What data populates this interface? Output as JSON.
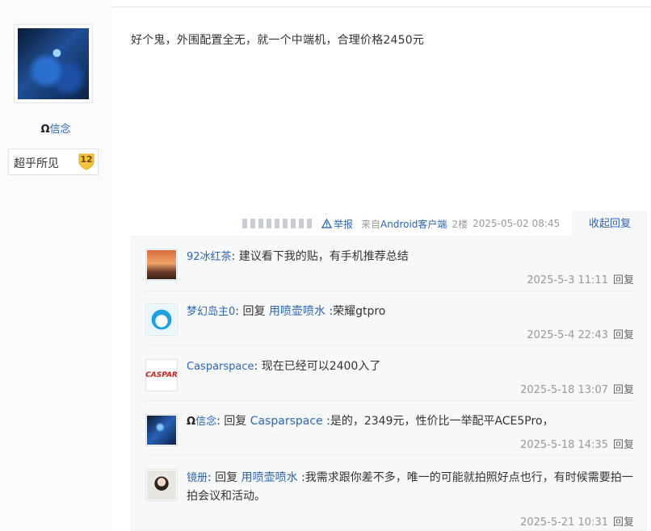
{
  "author": {
    "omega": "Ω",
    "name": "信念",
    "level_name": "超乎所见",
    "level": "12"
  },
  "post": {
    "content": "好个鬼，外围配置全无，就一个中端机，合理价格2450元",
    "report": "举报",
    "from_prefix": "来自",
    "client": "Android客户端",
    "floor": "2楼",
    "time": "2025-05-02 08:45",
    "collapse": "收起回复"
  },
  "replies": [
    {
      "user": "92冰红茶",
      "sep": ":",
      "content": " 建议看下我的贴，有手机推荐总结",
      "time": "2025-5-3 11:11",
      "reply_label": "回复"
    },
    {
      "user": "梦幻岛主0",
      "sep": ":",
      "reply_word": " 回复 ",
      "target": "用喷壶喷水",
      "content": " :荣耀gtpro",
      "time": "2025-5-4 22:43",
      "reply_label": "回复"
    },
    {
      "user": "Casparspace",
      "sep": ":",
      "content": " 现在已经可以2400入了",
      "time": "2025-5-18 13:07",
      "reply_label": "回复"
    },
    {
      "omega": "Ω",
      "user": "信念",
      "sep": ":",
      "reply_word": " 回复 ",
      "target": "Casparspace",
      "content": " :是的，2349元，性价比一举配平ACE5Pro，",
      "time": "2025-5-18 14:35",
      "reply_label": "回复"
    },
    {
      "user": "镜册",
      "sep": ":",
      "reply_word": " 回复 ",
      "target": "用喷壶喷水",
      "content": " :我需求跟你差不多，唯一的可能就拍照好点也行，有时候需要拍一拍会议和活动。",
      "time": "2025-5-21 10:31",
      "reply_label": "回复"
    }
  ],
  "icons": {
    "report": "warning-triangle-icon",
    "level": "shield-badge-icon"
  },
  "colors": {
    "link": "#2d64b3",
    "muted": "#999999",
    "badge": "#f5c542"
  }
}
